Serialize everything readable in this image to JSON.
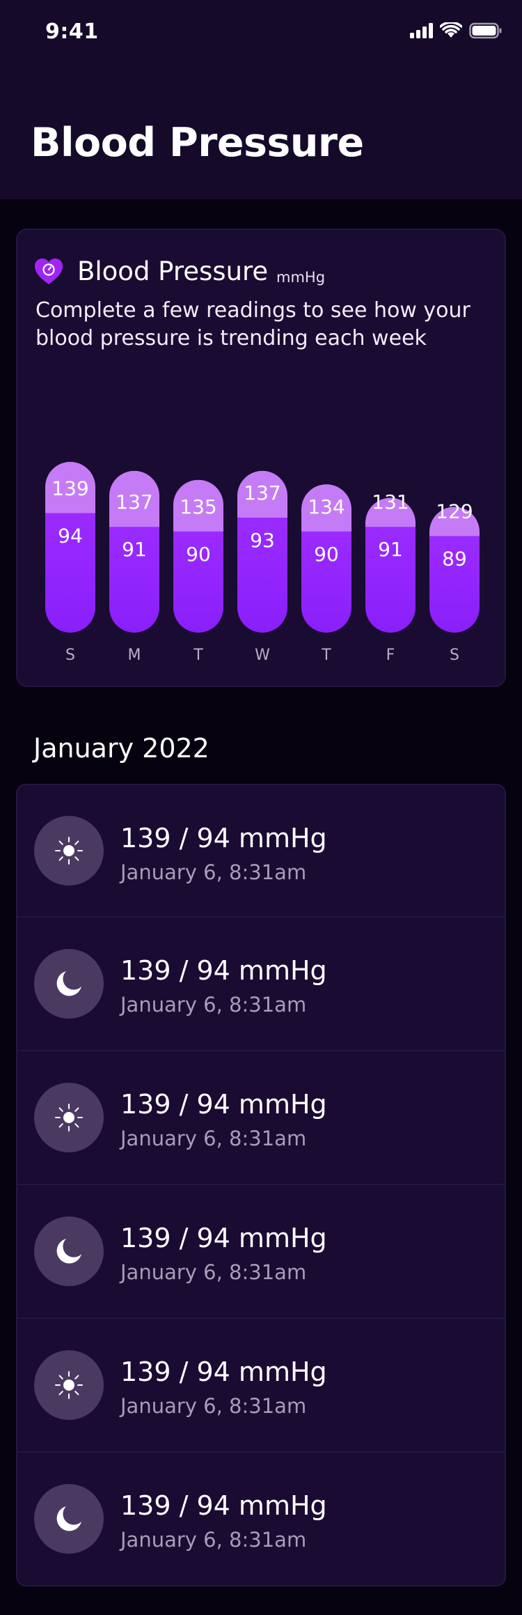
{
  "status_bar": {
    "time": "9:41"
  },
  "header": {
    "title": "Blood Pressure"
  },
  "card": {
    "title": "Blood Pressure",
    "unit": "mmHg",
    "description": "Complete a few readings to see how your blood pressure is trending each week"
  },
  "chart_data": {
    "type": "bar",
    "categories": [
      "S",
      "M",
      "T",
      "W",
      "T",
      "F",
      "S"
    ],
    "series": [
      {
        "values": [
          139,
          137,
          135,
          137,
          134,
          131,
          129
        ]
      },
      {
        "values": [
          94,
          91,
          90,
          93,
          90,
          91,
          89
        ]
      }
    ],
    "colors": {
      "systolic": "#c57bf6",
      "diastolic": "#8a1ffb",
      "diastolic_top": "#9a2bff"
    }
  },
  "month": "January 2022",
  "readings": [
    {
      "icon": "sun-icon",
      "value": "139 / 94 mmHg",
      "date": "January 6, 8:31am"
    },
    {
      "icon": "moon-icon",
      "value": "139 / 94 mmHg",
      "date": "January 6, 8:31am"
    },
    {
      "icon": "sun-icon",
      "value": "139 / 94 mmHg",
      "date": "January 6, 8:31am"
    },
    {
      "icon": "moon-icon",
      "value": "139 / 94 mmHg",
      "date": "January 6, 8:31am"
    },
    {
      "icon": "sun-icon",
      "value": "139 / 94 mmHg",
      "date": "January 6, 8:31am"
    },
    {
      "icon": "moon-icon",
      "value": "139 / 94 mmHg",
      "date": "January 6, 8:31am"
    }
  ]
}
